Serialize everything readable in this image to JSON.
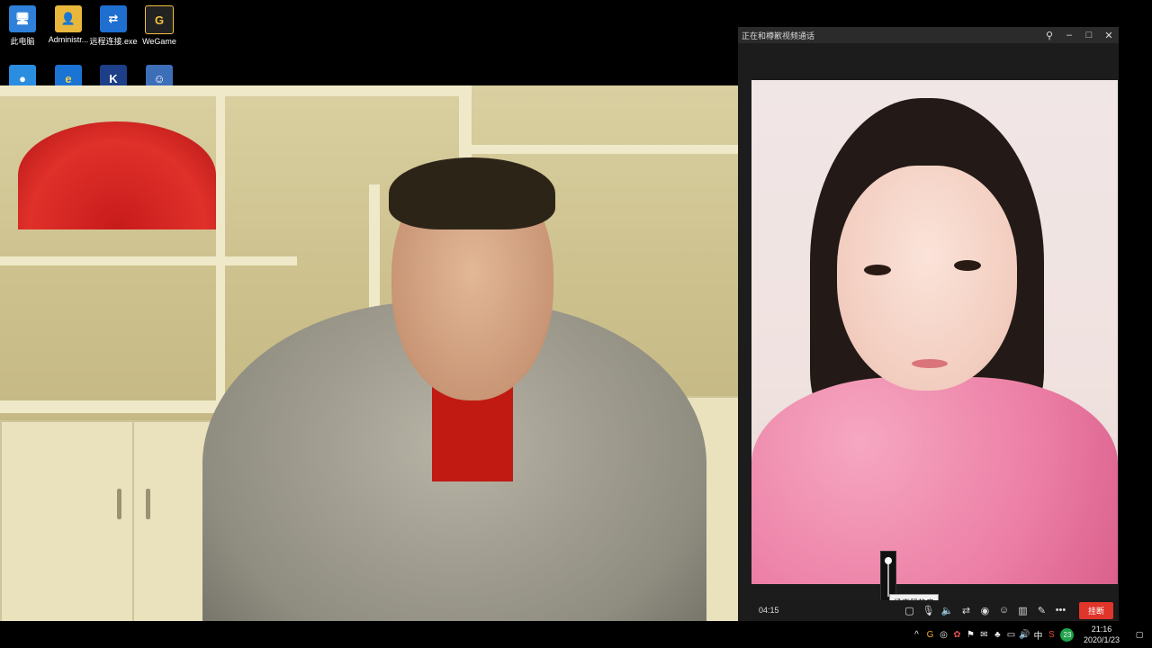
{
  "desktop": {
    "icons": [
      {
        "label": "此电脑",
        "icon": "computer-icon"
      },
      {
        "label": "Administr...",
        "icon": "user-folder-icon"
      },
      {
        "label": "远程连接.exe",
        "icon": "teamviewer-icon"
      },
      {
        "label": "WeGame",
        "icon": "wegame-icon"
      }
    ],
    "row2_icons": [
      "cloud-app-icon",
      "internet-explorer-icon",
      "kx-app-icon",
      "game-app-icon"
    ]
  },
  "call_window": {
    "title": "正在和樽歉视频通话",
    "window_buttons": {
      "pin": "⚲",
      "minimize": "–",
      "maximize": "□",
      "close": "✕"
    }
  },
  "call": {
    "timer": "04:15",
    "tooltip": "扬声器静音",
    "speaker_volume_percent": 95,
    "hangup_label": "挂断",
    "controls": [
      {
        "name": "chat-icon",
        "glyph": "▢"
      },
      {
        "name": "microphone-icon",
        "glyph": "🎙"
      },
      {
        "name": "speaker-icon",
        "glyph": "🔈"
      },
      {
        "name": "switch-camera-icon",
        "glyph": "⇄"
      },
      {
        "name": "camera-snapshot-icon",
        "glyph": "◉"
      },
      {
        "name": "effects-icon",
        "glyph": "☺"
      },
      {
        "name": "layout-icon",
        "glyph": "▥"
      },
      {
        "name": "whiteboard-icon",
        "glyph": "✎"
      },
      {
        "name": "more-icon",
        "glyph": "•••"
      }
    ]
  },
  "taskbar": {
    "tray_icons": [
      "^",
      "G",
      "◎",
      "✿",
      "⚑",
      "✉",
      "♣",
      "▭",
      "🔊",
      "中",
      "S"
    ],
    "badge_count": "23",
    "time": "21:16",
    "date": "2020/1/23",
    "notification_glyph": "▢"
  },
  "colors": {
    "hangup": "#e0352b",
    "accent_badge": "#1fa34a"
  }
}
